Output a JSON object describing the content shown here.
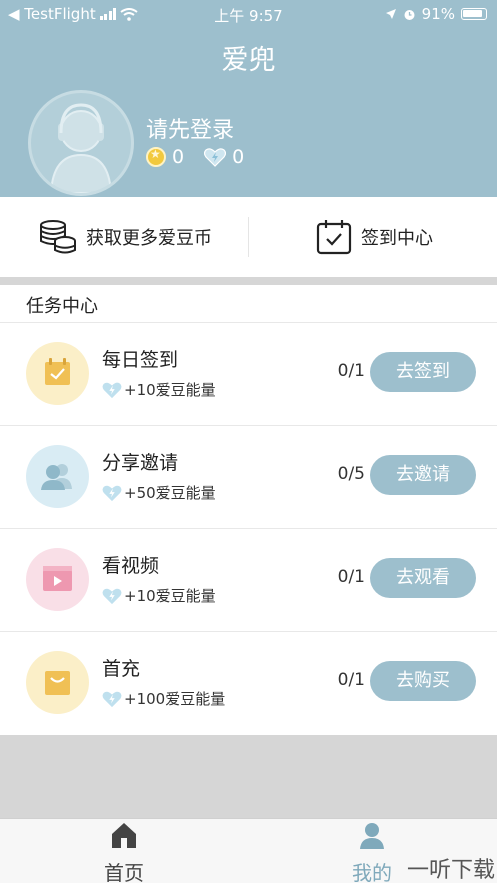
{
  "status_bar": {
    "carrier": "◀ TestFlight",
    "time": "上午 9:57",
    "battery": "91%"
  },
  "header": {
    "title": "爱兜",
    "login_prompt": "请先登录",
    "coin_count": "0",
    "energy_count": "0"
  },
  "actions": {
    "get_coins": "获取更多爱豆币",
    "checkin_center": "签到中心"
  },
  "tasks": {
    "header": "任务中心",
    "items": [
      {
        "name": "每日签到",
        "reward": "+10爱豆能量",
        "progress": "0/1",
        "button": "去签到"
      },
      {
        "name": "分享邀请",
        "reward": "+50爱豆能量",
        "progress": "0/5",
        "button": "去邀请"
      },
      {
        "name": "看视频",
        "reward": "+10爱豆能量",
        "progress": "0/1",
        "button": "去观看"
      },
      {
        "name": "首充",
        "reward": "+100爱豆能量",
        "progress": "0/1",
        "button": "去购买"
      }
    ]
  },
  "tabbar": {
    "home": "首页",
    "mine": "我的"
  },
  "watermark": "一听下载",
  "colors": {
    "accent": "#9dbfcd",
    "home_tab": "#444444",
    "mine_tab": "#7fa9bb"
  },
  "icons": [
    "signal-icon",
    "wifi-icon",
    "location-icon",
    "alarm-icon",
    "battery-icon",
    "avatar-icon",
    "coin-icon",
    "energy-heart-icon",
    "coins-stack-icon",
    "calendar-check-icon",
    "calendar-icon",
    "users-icon",
    "video-icon",
    "shopping-bag-icon",
    "home-icon",
    "user-icon"
  ]
}
